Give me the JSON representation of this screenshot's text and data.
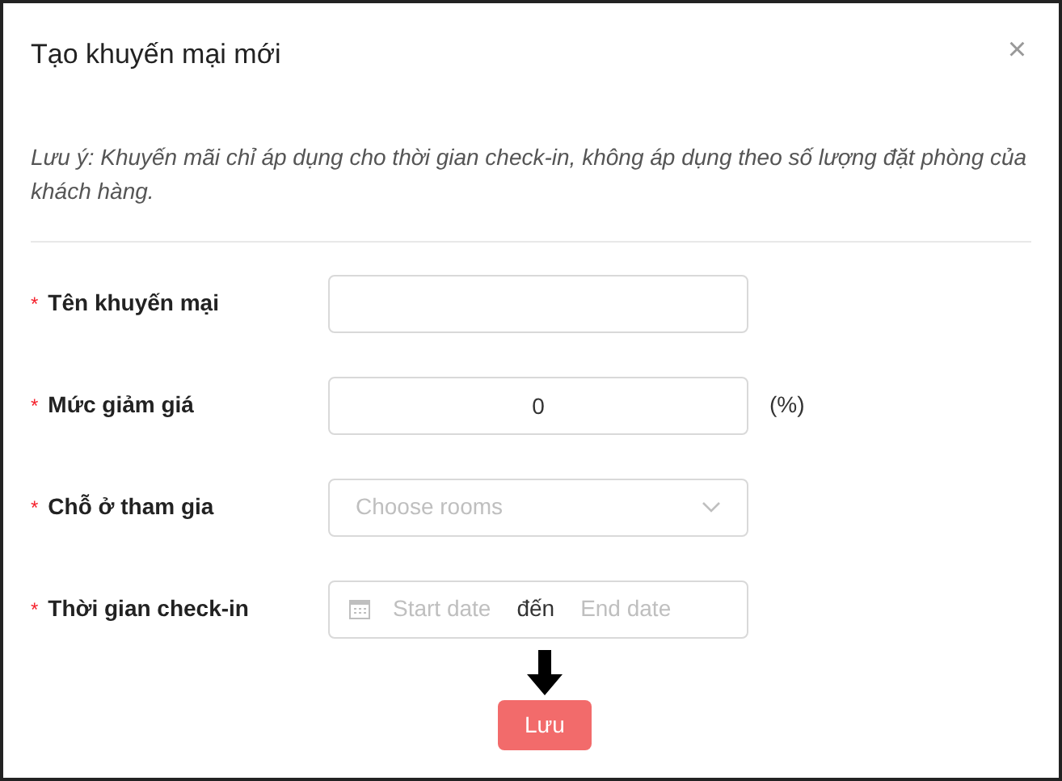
{
  "dialog": {
    "title": "Tạo khuyến mại mới",
    "close": "×"
  },
  "note": "Lưu ý: Khuyến mãi chỉ áp dụng cho thời gian check-in, không áp dụng theo số lượng đặt phòng của khách hàng.",
  "fields": [
    {
      "kind": "text",
      "label": "Tên khuyến mại",
      "required_mark": "*"
    },
    {
      "kind": "number",
      "label": "Mức giảm giá",
      "required_mark": "*",
      "value": "0",
      "suffix": "(%)"
    },
    {
      "kind": "select",
      "label": "Chỗ ở tham gia",
      "required_mark": "*",
      "placeholder": "Choose rooms"
    },
    {
      "kind": "daterange",
      "label": "Thời gian check-in",
      "required_mark": "*",
      "start_placeholder": "Start date",
      "separator": "đến",
      "end_placeholder": "End date"
    }
  ],
  "submit": "Lưu"
}
